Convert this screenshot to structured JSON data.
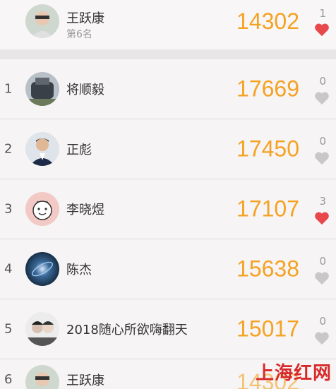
{
  "me": {
    "name": "王跃康",
    "rank_label": "第6名",
    "score": "14302",
    "likes": "1",
    "liked": true
  },
  "leaderboard": [
    {
      "rank": "1",
      "name": "将顺毅",
      "score": "17669",
      "likes": "0",
      "liked": false
    },
    {
      "rank": "2",
      "name": "正彪",
      "score": "17450",
      "likes": "0",
      "liked": false
    },
    {
      "rank": "3",
      "name": "李晓煜",
      "score": "17107",
      "likes": "3",
      "liked": true
    },
    {
      "rank": "4",
      "name": "陈杰",
      "score": "15638",
      "likes": "0",
      "liked": false
    },
    {
      "rank": "5",
      "name": "2018随心所欲嗨翻天",
      "score": "15017",
      "likes": "0",
      "liked": false
    },
    {
      "rank": "6",
      "name": "王跃康",
      "score": "14302"
    }
  ],
  "colors": {
    "score": "#f5a223",
    "heart_active": "#e8474c",
    "heart_inactive": "#c8c8c8"
  },
  "watermark": "上海红网"
}
